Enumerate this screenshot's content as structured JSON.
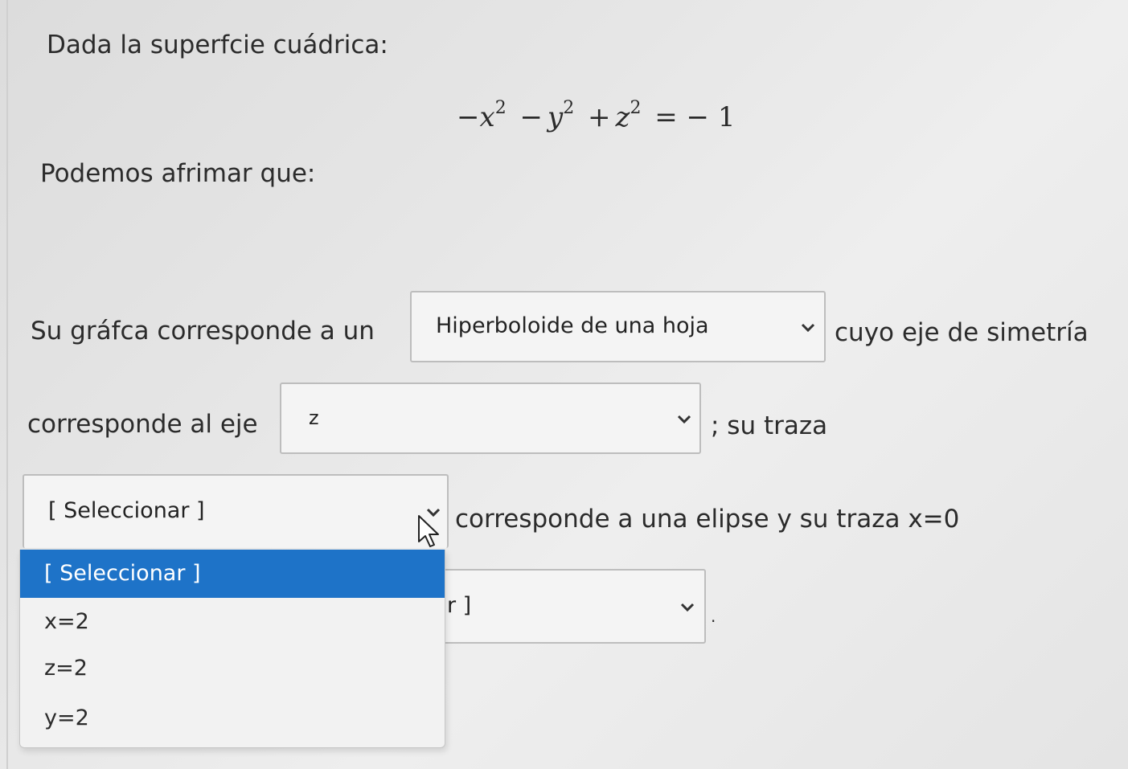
{
  "question": {
    "title": "Dada la superfcie cuádrica:",
    "equation": {
      "t1_sign": "−",
      "t1_var": "x",
      "t1_exp": "2",
      "op1": "−",
      "t2_var": "y",
      "t2_exp": "2",
      "op2": "+",
      "t3_var": "z",
      "t3_exp": "2",
      "rhs": "= − 1"
    },
    "intro": "Podemos afrimar que:"
  },
  "sentence": {
    "part1": "Su gráfca corresponde a un",
    "part2": "cuyo eje de simetría",
    "part3": "corresponde al eje",
    "part4": "; su traza",
    "part5": "corresponde a una elipse y su traza x=0",
    "end": "."
  },
  "selects": {
    "surface_type": {
      "value": "Hiperboloide de una hoja"
    },
    "axis": {
      "value": "z"
    },
    "trace_plane": {
      "value": "[ Seleccionar ]"
    },
    "trace_x0": {
      "value": "r ]"
    }
  },
  "dropdown": {
    "options": [
      "[ Seleccionar ]",
      "x=2",
      "z=2",
      "y=2"
    ],
    "selected_index": 0
  },
  "colors": {
    "highlight": "#1e73c8",
    "background": "#e6e6e6",
    "select_border": "#bdbdbd"
  },
  "icons": {
    "chevron": "chevron-down-icon",
    "cursor": "mouse-pointer-icon"
  }
}
